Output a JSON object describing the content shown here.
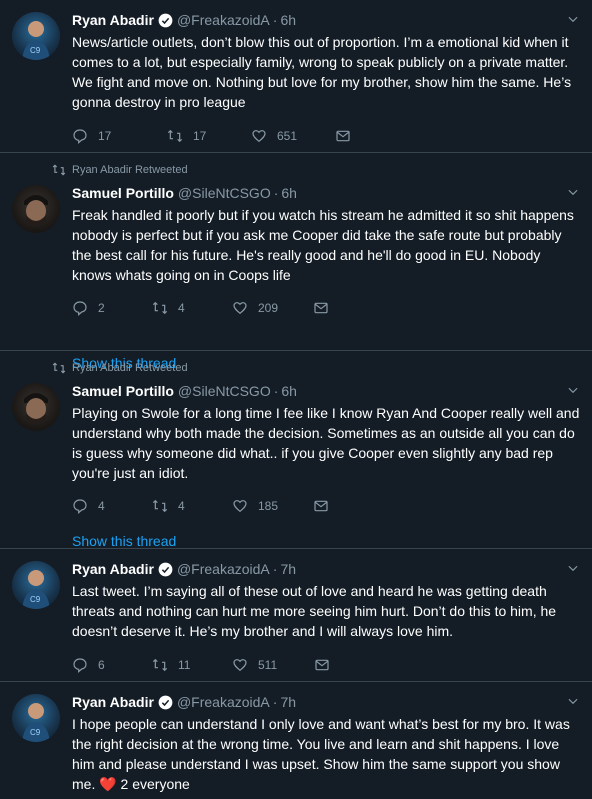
{
  "tweets": [
    {
      "retweet_label": "",
      "author": "Ryan Abadir",
      "handle": "@FreakazoidA",
      "time": "6h",
      "text": "News/article outlets, don’t blow this out of proportion. I’m a emotional kid when it comes to a lot, but especially family, wrong to speak publicly on a private matter. We fight and move on. Nothing but love for my brother, show him the same. He’s gonna destroy in pro league",
      "replies": "17",
      "retweets": "17",
      "likes": "651",
      "thread_link": ""
    },
    {
      "retweet_label": "Ryan Abadir Retweeted",
      "author": "Samuel Portillo",
      "handle": "@SileNtCSGO",
      "time": "6h",
      "text": "Freak handled it poorly but if you watch his stream he admitted it so shit happens nobody is perfect but if you ask me Cooper did take the safe route but probably the best call for his future. He's really good and he'll do good in EU. Nobody knows whats going on in Coops life",
      "replies": "2",
      "retweets": "4",
      "likes": "209",
      "thread_link": "Show this thread"
    },
    {
      "retweet_label": "Ryan Abadir Retweeted",
      "author": "Samuel Portillo",
      "handle": "@SileNtCSGO",
      "time": "6h",
      "text": "Playing on Swole for a long time I fee like I know Ryan And Cooper really well and understand why both made the decision. Sometimes as an outside all you can do is guess why someone did what.. if you give Cooper even slightly any bad rep you're just an idiot.",
      "replies": "4",
      "retweets": "4",
      "likes": "185",
      "thread_link": "Show this thread"
    },
    {
      "retweet_label": "",
      "author": "Ryan Abadir",
      "handle": "@FreakazoidA",
      "time": "7h",
      "text": "Last tweet. I’m saying all of these out of love and heard he was getting death threats and nothing can hurt me more seeing him hurt. Don’t do this to him, he doesn’t deserve it. He’s my brother and I will always love him.",
      "replies": "6",
      "retweets": "11",
      "likes": "511",
      "thread_link": ""
    },
    {
      "retweet_label": "",
      "author": "Ryan Abadir",
      "handle": "@FreakazoidA",
      "time": "7h",
      "text": "I hope people can understand I only love and want what’s best for my bro. It was the right decision at the wrong time. You live and learn and shit happens. I love him and please understand I was upset. Show him the same support you show me.",
      "text_suffix": " 2 everyone",
      "heart": "❤️",
      "replies": "",
      "retweets": "",
      "likes": "",
      "thread_link": ""
    }
  ],
  "colors": {
    "background": "#141d26",
    "text": "#ffffff",
    "muted": "#8899a6",
    "link": "#1da1f2",
    "divider": "#38444d",
    "verified": "#1da1f2"
  }
}
